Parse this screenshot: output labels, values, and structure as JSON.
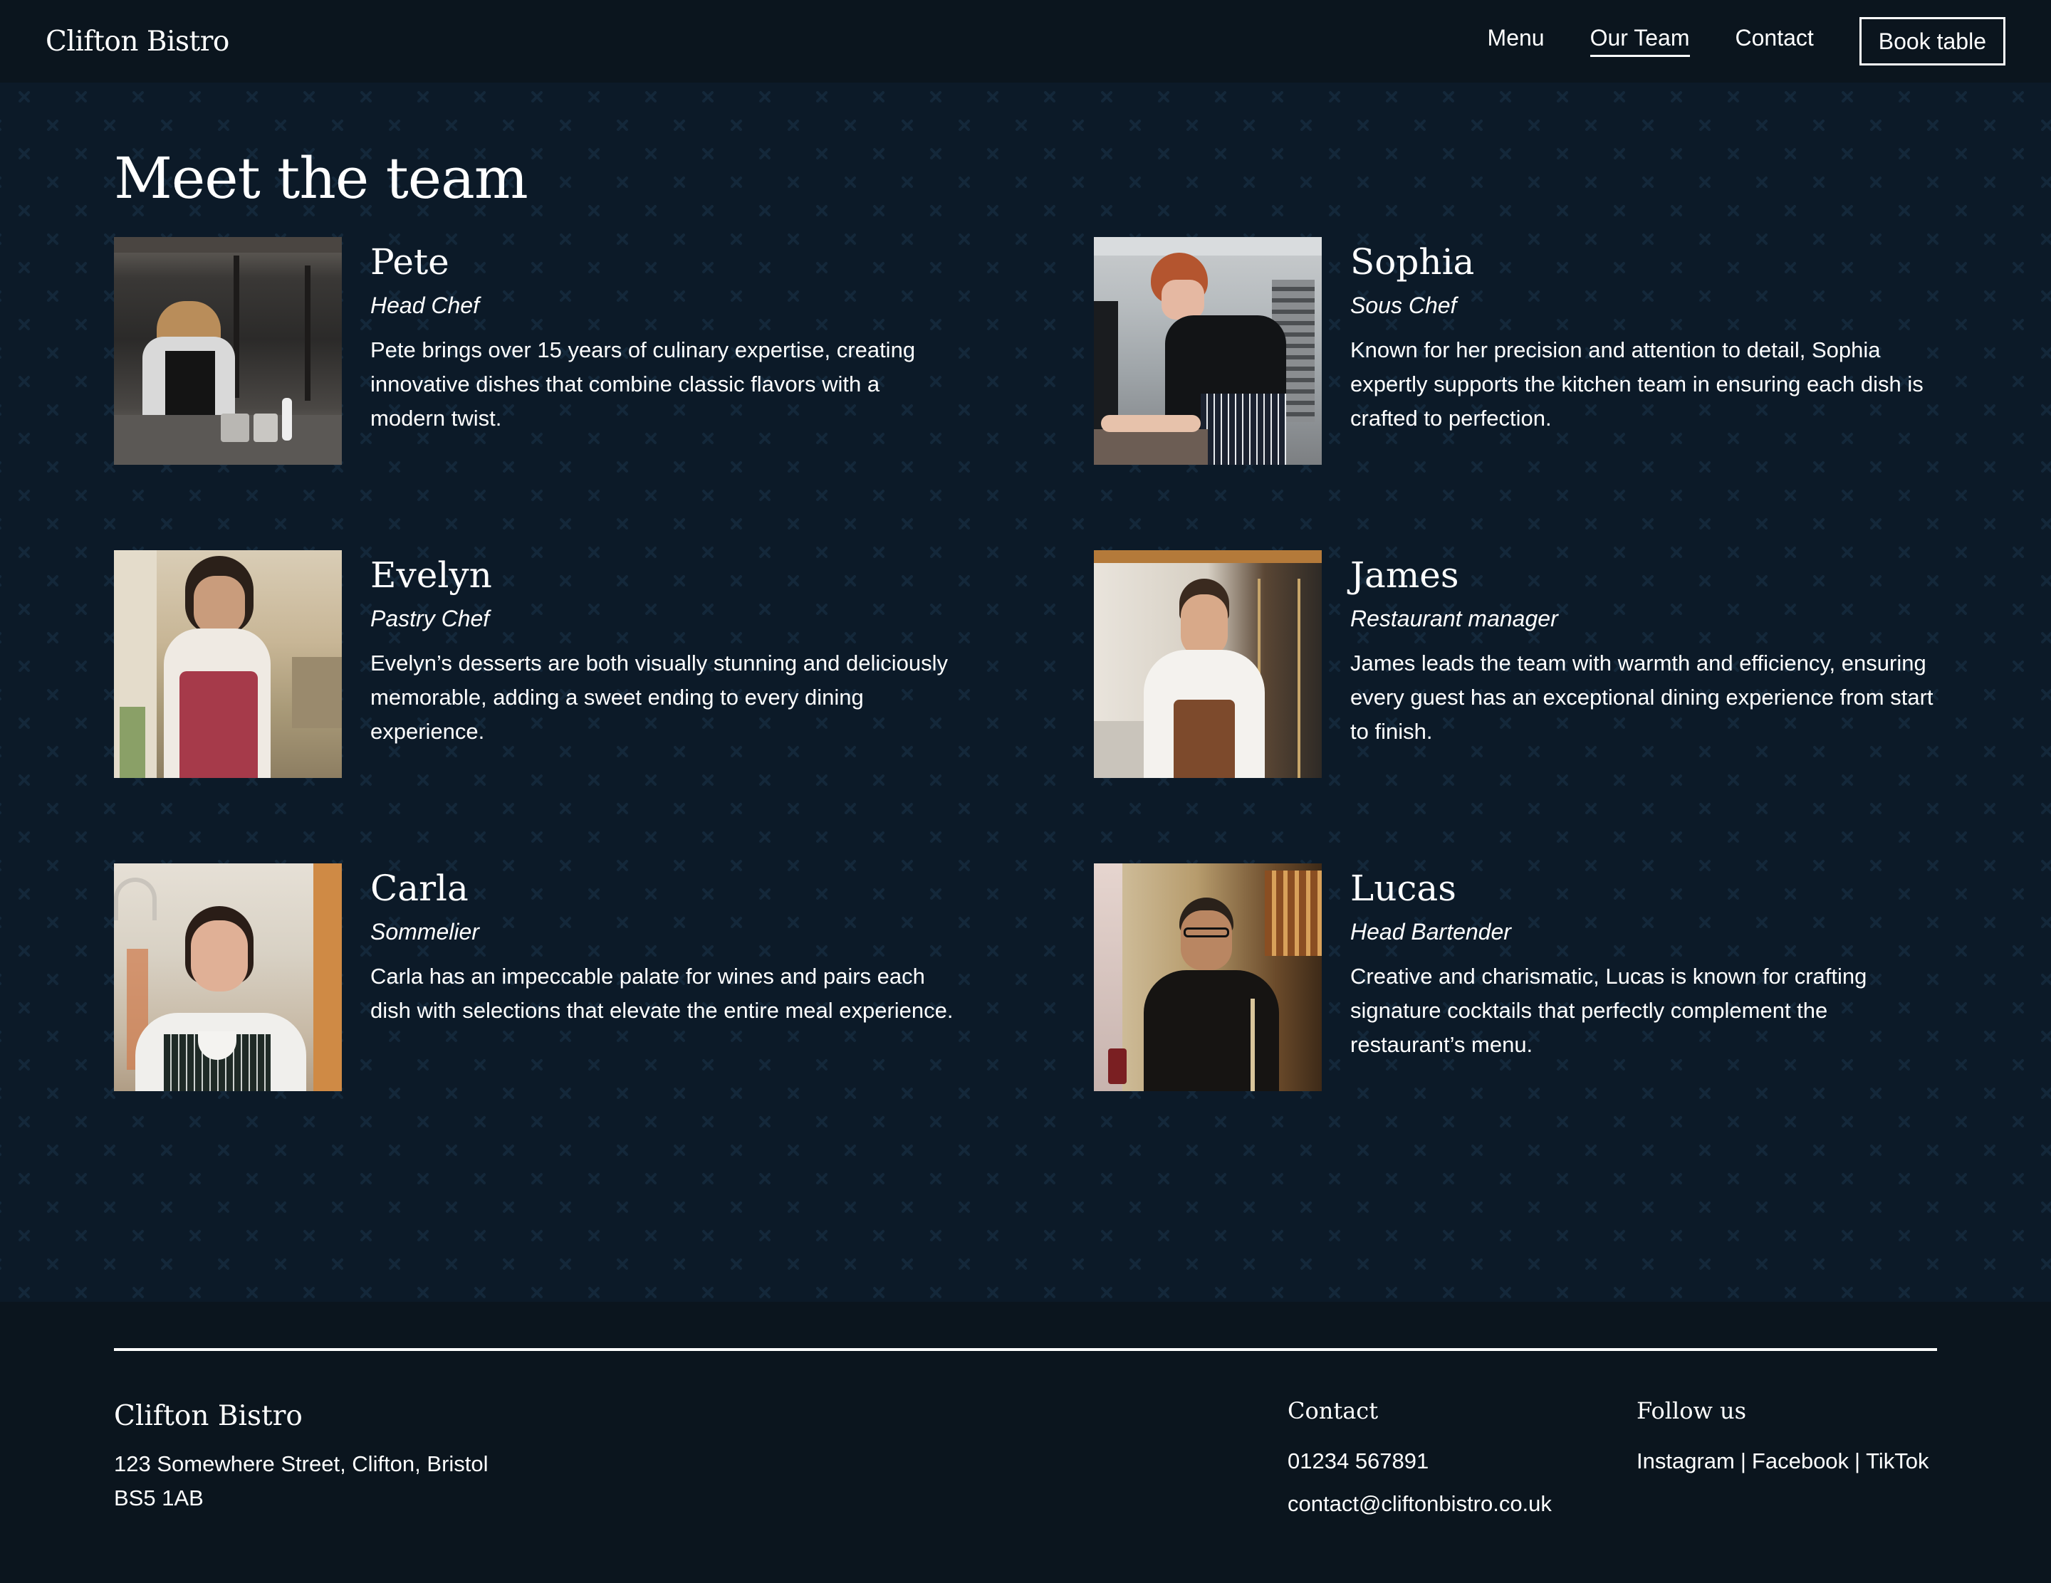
{
  "header": {
    "brand": "Clifton Bistro",
    "nav": [
      {
        "label": "Menu",
        "active": false
      },
      {
        "label": "Our Team",
        "active": true
      },
      {
        "label": "Contact",
        "active": false
      }
    ],
    "cta_label": "Book table"
  },
  "main": {
    "title": "Meet the team",
    "members": [
      {
        "name": "Pete",
        "role": "Head Chef",
        "bio": "Pete brings over 15 years of culinary expertise, creating innovative dishes that combine classic flavors with a modern twist.",
        "photo": "chef-in-kitchen-photo"
      },
      {
        "name": "Sophia",
        "role": "Sous Chef",
        "bio": "Known for her precision and attention to detail, Sophia expertly supports the kitchen team in ensuring each dish is crafted to perfection.",
        "photo": "sous-chef-plating-photo"
      },
      {
        "name": "Evelyn",
        "role": "Pastry Chef",
        "bio": "Evelyn’s desserts are both visually stunning and deliciously memorable, adding a sweet ending to every dining experience.",
        "photo": "pastry-chef-baking-photo"
      },
      {
        "name": "James",
        "role": "Restaurant manager",
        "bio": "James leads the team with warmth and efficiency, ensuring every guest has an exceptional dining experience from start to finish.",
        "photo": "manager-in-dining-room-photo"
      },
      {
        "name": "Carla",
        "role": "Sommelier",
        "bio": "Carla has an impeccable palate for wines and pairs each dish with selections that elevate the entire meal experience.",
        "photo": "sommelier-portrait-photo"
      },
      {
        "name": "Lucas",
        "role": "Head Bartender",
        "bio": "Creative and charismatic, Lucas is known for crafting signature cocktails that perfectly complement the restaurant’s menu.",
        "photo": "bartender-at-bar-photo"
      }
    ]
  },
  "footer": {
    "brand": "Clifton Bistro",
    "address_line1": "123 Somewhere Street, Clifton, Bristol",
    "address_line2": "BS5 1AB",
    "contact": {
      "heading": "Contact",
      "phone": "01234 567891",
      "email": "contact@cliftonbistro.co.uk"
    },
    "follow": {
      "heading": "Follow us",
      "links": [
        "Instagram",
        "Facebook",
        "TikTok"
      ],
      "separator": "|"
    }
  },
  "colors": {
    "header_bg": "#0b151e",
    "main_bg": "#0c1a28",
    "pattern": "#14283a",
    "text": "#ffffff"
  }
}
